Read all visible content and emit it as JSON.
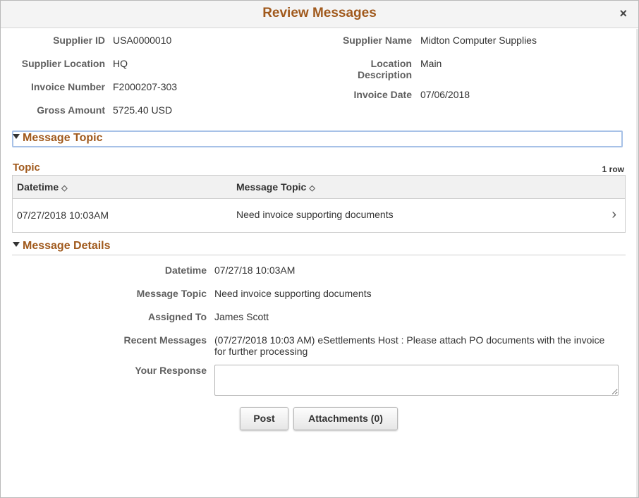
{
  "dialog": {
    "title": "Review Messages",
    "close_glyph": "×"
  },
  "summary": {
    "supplier_id_label": "Supplier ID",
    "supplier_id": "USA0000010",
    "supplier_location_label": "Supplier Location",
    "supplier_location": "HQ",
    "invoice_number_label": "Invoice Number",
    "invoice_number": "F2000207-303",
    "gross_amount_label": "Gross Amount",
    "gross_amount": "5725.40 USD",
    "supplier_name_label": "Supplier Name",
    "supplier_name": "Midton Computer Supplies",
    "location_desc_label_1": "Location",
    "location_desc_label_2": "Description",
    "location_desc": "Main",
    "invoice_date_label": "Invoice Date",
    "invoice_date": "07/06/2018"
  },
  "message_topic_section": {
    "title": "Message Topic"
  },
  "topic_grid": {
    "title": "Topic",
    "row_count": "1 row",
    "columns": [
      "Datetime",
      "Message Topic"
    ],
    "sort_icon": "◇",
    "rows": [
      {
        "datetime": "07/27/2018 10:03AM",
        "topic": "Need invoice supporting documents",
        "chevron": "›"
      }
    ]
  },
  "message_details": {
    "title": "Message Details",
    "datetime_label": "Datetime",
    "datetime": "07/27/18 10:03AM",
    "topic_label": "Message Topic",
    "topic": "Need invoice supporting documents",
    "assigned_label": "Assigned To",
    "assigned": "James Scott",
    "recent_label": "Recent Messages",
    "recent_line1": "(07/27/2018 10:03 AM) eSettlements Host : Please attach PO documents with the invoice",
    "recent_line2": "for further processing",
    "response_label": "Your Response",
    "response_value": ""
  },
  "buttons": {
    "post": "Post",
    "attachments": "Attachments (0)"
  },
  "icons": {
    "close": "close-icon",
    "collapse": "triangle-down-icon",
    "sort": "sort-icon",
    "row_detail": "chevron-right-icon"
  },
  "colors": {
    "accent": "#a0591c",
    "focus_border": "#a7c1e7"
  }
}
